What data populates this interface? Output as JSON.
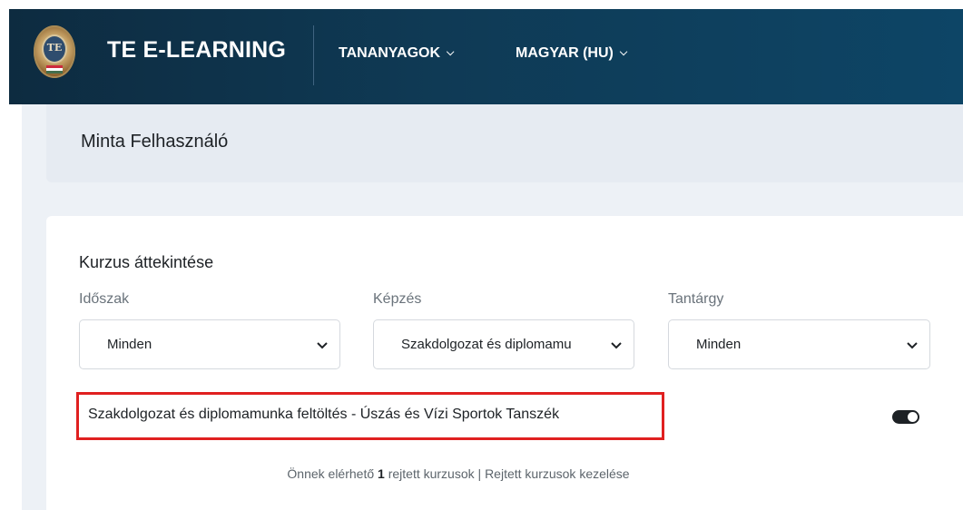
{
  "header": {
    "brand": "TE E-LEARNING",
    "nav": [
      {
        "label": "TANANYAGOK"
      },
      {
        "label": "MAGYAR (HU)"
      }
    ],
    "logo_text": "TE"
  },
  "user": {
    "name": "Minta Felhasználó"
  },
  "overview": {
    "title": "Kurzus áttekintése",
    "filters": [
      {
        "label": "Időszak",
        "value": "Minden"
      },
      {
        "label": "Képzés",
        "value": "Szakdolgozat és diplomamu"
      },
      {
        "label": "Tantárgy",
        "value": "Minden"
      }
    ],
    "course": {
      "title": "Szakdolgozat és diplomamunka feltöltés - Úszás és Vízi Sportok Tanszék",
      "highlight_color": "#e02020"
    },
    "footer": {
      "prefix": "Önnek elérhető",
      "count": "1",
      "suffix": "rejtett kurzusok",
      "separator": "|",
      "link": "Rejtett kurzusok kezelése"
    }
  },
  "colors": {
    "navbar": "#0f3a55",
    "page_bg": "#edf1f6",
    "card_bg": "#ffffff"
  },
  "icons": {
    "nav_chevron": "chevron-down-icon",
    "select_arrow": "chevron-down-icon",
    "toggle": "toggle-icon"
  }
}
